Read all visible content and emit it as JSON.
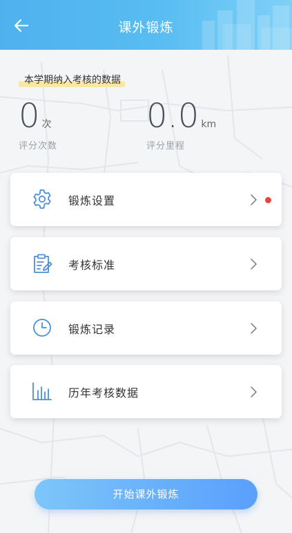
{
  "header": {
    "title": "课外锻炼",
    "back_icon": "back-arrow-icon",
    "background": "#55b7f0"
  },
  "stats": {
    "caption": "本学期纳入考核的数据",
    "count": {
      "value": "0",
      "unit": "次",
      "label": "评分次数"
    },
    "distance": {
      "value": "0.0",
      "unit": "km",
      "label": "评分里程"
    }
  },
  "menu": [
    {
      "label": "锻炼设置",
      "icon": "gear-icon",
      "has_badge": true
    },
    {
      "label": "考核标准",
      "icon": "clipboard-icon",
      "has_badge": false
    },
    {
      "label": "锻炼记录",
      "icon": "clock-icon",
      "has_badge": false
    },
    {
      "label": "历年考核数据",
      "icon": "bar-chart-icon",
      "has_badge": false
    }
  ],
  "start_button": {
    "label": "开始课外锻炼"
  },
  "colors": {
    "accent": "#4a90d9",
    "badge": "#e9453d",
    "button_start": "#7cc6fa",
    "button_end": "#5a9ffc"
  }
}
